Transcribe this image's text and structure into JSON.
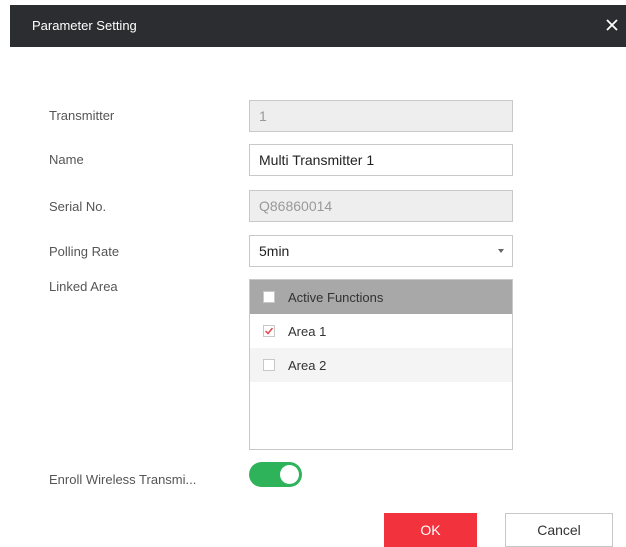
{
  "dialog": {
    "title": "Parameter Setting",
    "close_icon": "close-icon"
  },
  "form": {
    "transmitter": {
      "label": "Transmitter",
      "value": "1"
    },
    "name": {
      "label": "Name",
      "value": "Multi Transmitter 1"
    },
    "serial": {
      "label": "Serial No.",
      "value": "Q86860014"
    },
    "polling_rate": {
      "label": "Polling Rate",
      "value": "5min"
    },
    "linked_area": {
      "label": "Linked Area",
      "header": "Active Functions",
      "header_checked": false,
      "items": [
        {
          "label": "Area 1",
          "checked": true
        },
        {
          "label": "Area 2",
          "checked": false
        }
      ]
    },
    "enroll": {
      "label": "Enroll Wireless Transmi...",
      "enabled": true
    }
  },
  "buttons": {
    "ok": "OK",
    "cancel": "Cancel"
  },
  "colors": {
    "titlebar": "#2b2d30",
    "primary": "#f2323c",
    "toggle_on": "#2fb35a",
    "checkmark": "#e8454e"
  }
}
